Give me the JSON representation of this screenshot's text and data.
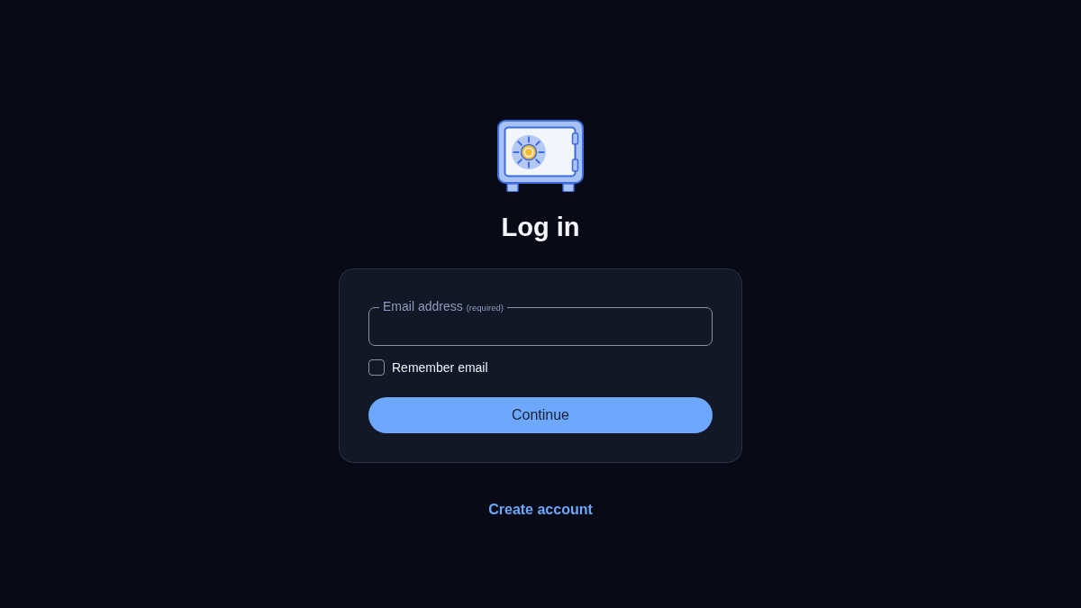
{
  "header": {
    "title": "Log in"
  },
  "form": {
    "email_field": {
      "label": "Email address",
      "hint": "(required)"
    },
    "remember": {
      "label": "Remember email",
      "checked": false
    },
    "submit_button": "Continue"
  },
  "footer": {
    "create_account_link": "Create account"
  }
}
